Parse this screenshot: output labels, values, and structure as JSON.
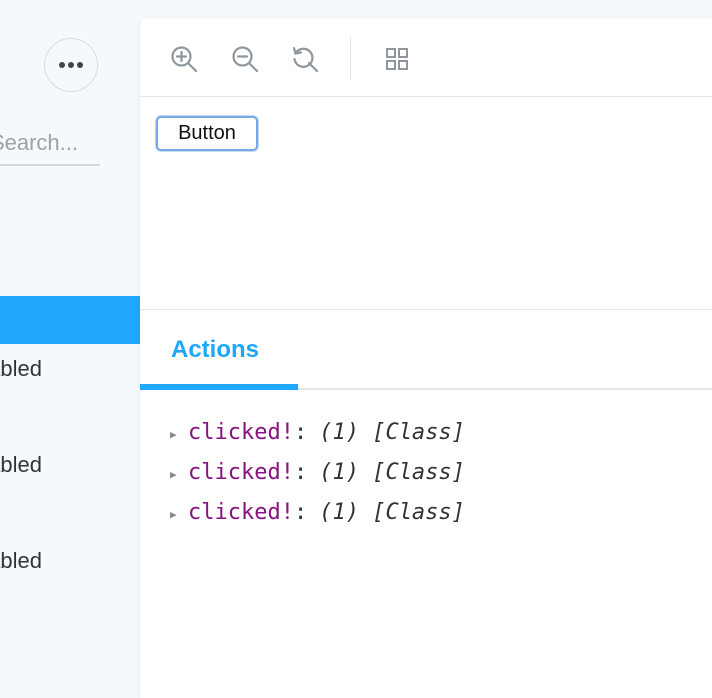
{
  "sidebar": {
    "search_placeholder": "Search...",
    "items": [
      {
        "label": "",
        "active": true
      },
      {
        "label": "Enabled"
      },
      {
        "label": "Disabled"
      },
      {
        "label": "Not disabled"
      }
    ]
  },
  "toolbar": {
    "icons": [
      "zoom-in-icon",
      "zoom-out-icon",
      "reset-zoom-icon",
      "grid-icon"
    ]
  },
  "preview": {
    "button_label": "Button"
  },
  "addons": {
    "tabs": [
      {
        "label": "Actions",
        "active": true
      }
    ]
  },
  "actions_log": [
    {
      "name": "clicked!",
      "separator": ":",
      "value": "(1) [Class]"
    },
    {
      "name": "clicked!",
      "separator": ":",
      "value": "(1) [Class]"
    },
    {
      "name": "clicked!",
      "separator": ":",
      "value": "(1) [Class]"
    }
  ],
  "colors": {
    "accent": "#1ea7fd",
    "log_name": "#881280",
    "sidebar_bg": "#f6f9fc"
  }
}
